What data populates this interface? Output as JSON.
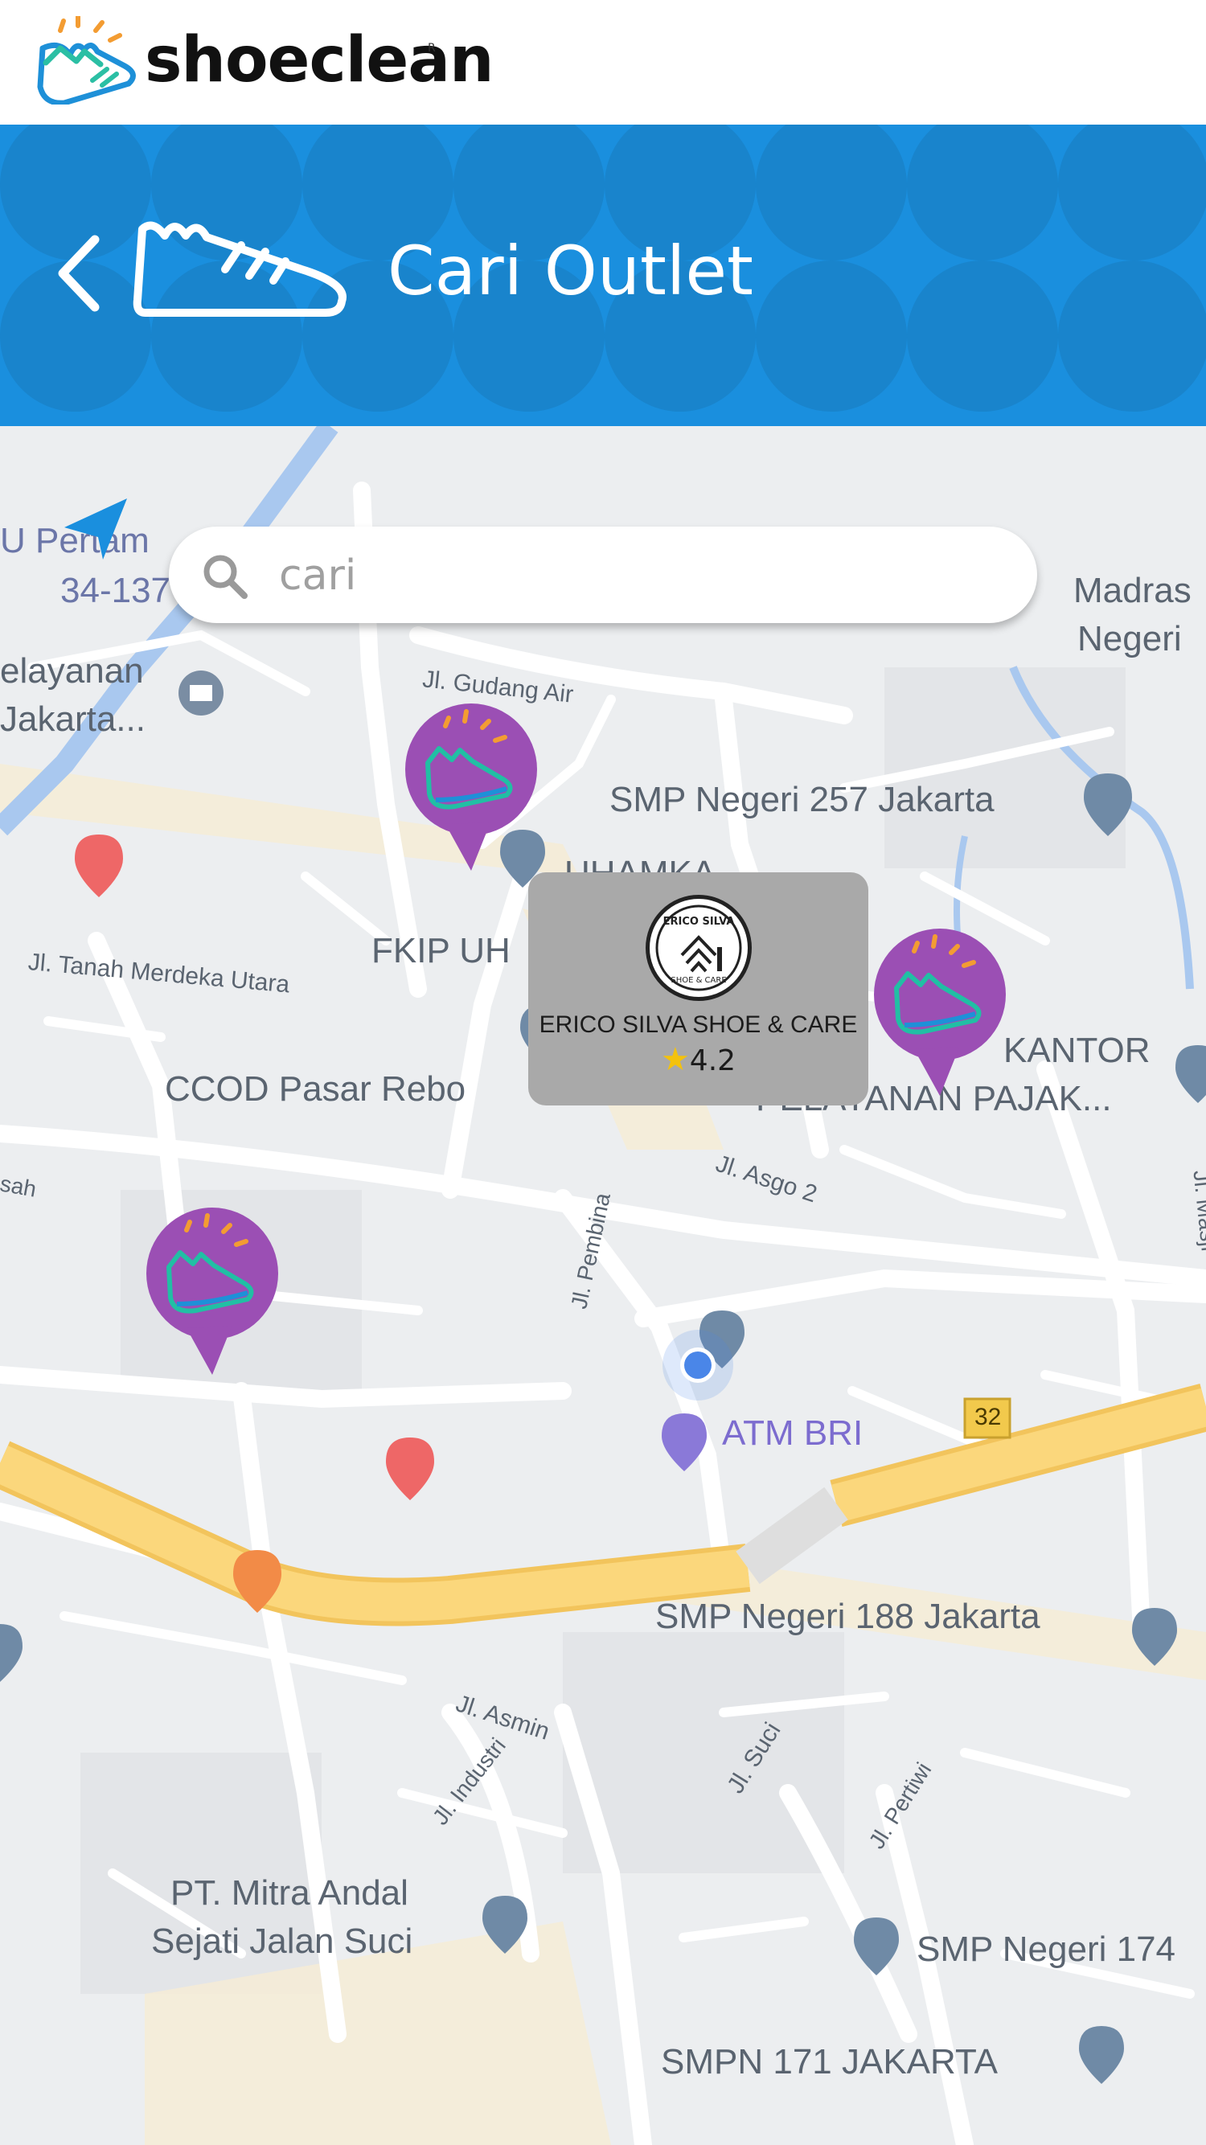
{
  "app": {
    "brand": "shoeclean",
    "registered": "R"
  },
  "header": {
    "title": "Cari Outlet",
    "back_icon": "chevron-left-icon",
    "logo_icon": "sneaker-icon"
  },
  "search": {
    "placeholder": "cari",
    "value": ""
  },
  "map": {
    "labels": [
      "U Pertam",
      "34-137",
      "Madras",
      "Negeri",
      "elayanan",
      "Jakarta...",
      "Jl. Gudang Air",
      "SMP Negeri 257 Jakarta",
      "UHAMKA",
      "FKIP UH",
      "Jl. Tanah Merdeka Utara",
      "CCOD Pasar Rebo",
      "KANTOR",
      "PELAYANAN PAJAK...",
      "Jl. Asgo 2",
      "Jl. Pembina",
      "ATM BRI",
      "32",
      "SMP Negeri 188 Jakarta",
      "Jl. Asmin",
      "Jl. Industri",
      "Jl. Suci",
      "Jl. Pertiwi",
      "PT. Mitra Andal",
      "Sejati Jalan Suci",
      "SMP Negeri 174",
      "SMPN 171 JAKARTA",
      "Jl. Masji",
      "sah"
    ]
  },
  "outlet": {
    "name": "ERICO SILVA SHOE & CARE",
    "rating": "4.2",
    "logo_top": "ERICO SILVA",
    "logo_bottom": "SHOE & CARE"
  },
  "colors": {
    "header_blue": "#1a8fde",
    "pin_purple": "#9b4fb4",
    "road_yellow": "#fbd77c",
    "card_gray": "#a9a9a9"
  }
}
